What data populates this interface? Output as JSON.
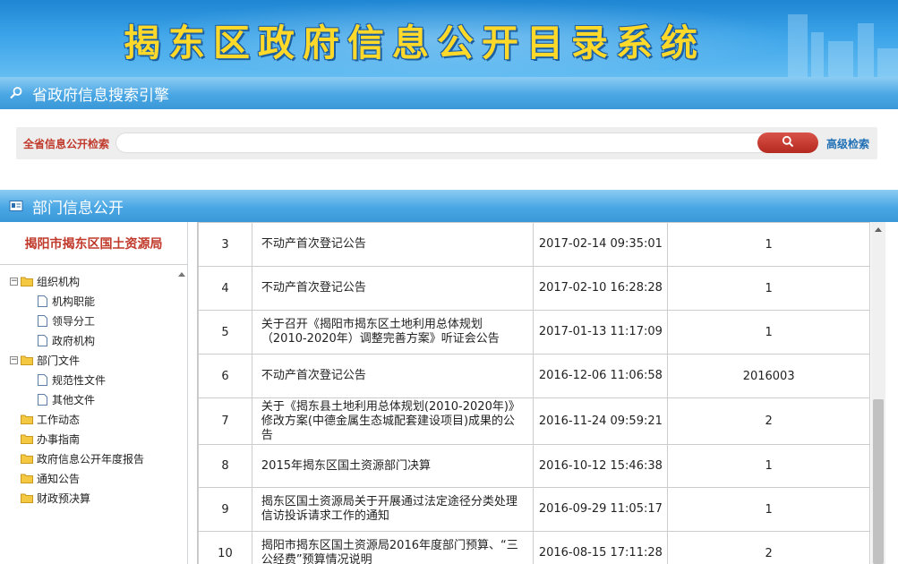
{
  "banner": {
    "title": "揭东区政府信息公开目录系统"
  },
  "search_section": {
    "title": "省政府信息搜索引擎",
    "label": "全省信息公开检索",
    "input_value": "",
    "advanced_label": "高级检索"
  },
  "dept_section": {
    "title": "部门信息公开"
  },
  "dept": {
    "name": "揭阳市揭东区国土资源局"
  },
  "tree": [
    {
      "label": "组织机构",
      "type": "folder",
      "toggle": "−"
    },
    {
      "label": "机构职能",
      "type": "doc"
    },
    {
      "label": "领导分工",
      "type": "doc"
    },
    {
      "label": "政府机构",
      "type": "doc"
    },
    {
      "label": "部门文件",
      "type": "folder",
      "toggle": "−"
    },
    {
      "label": "规范性文件",
      "type": "doc"
    },
    {
      "label": "其他文件",
      "type": "doc"
    },
    {
      "label": "工作动态",
      "type": "folder"
    },
    {
      "label": "办事指南",
      "type": "folder"
    },
    {
      "label": "政府信息公开年度报告",
      "type": "folder"
    },
    {
      "label": "通知公告",
      "type": "folder"
    },
    {
      "label": "财政预决算",
      "type": "folder"
    }
  ],
  "rows": [
    {
      "num": "3",
      "title": "不动产首次登记公告",
      "date": "2017-02-14 09:35:01",
      "doc_no": "1"
    },
    {
      "num": "4",
      "title": "不动产首次登记公告",
      "date": "2017-02-10 16:28:28",
      "doc_no": "1"
    },
    {
      "num": "5",
      "title": "关于召开《揭阳市揭东区土地利用总体规划（2010-2020年）调整完善方案》听证会公告",
      "date": "2017-01-13 11:17:09",
      "doc_no": "1"
    },
    {
      "num": "6",
      "title": "不动产首次登记公告",
      "date": "2016-12-06 11:06:58",
      "doc_no": "2016003"
    },
    {
      "num": "7",
      "title": "关于《揭东县土地利用总体规划(2010-2020年)》修改方案(中德金属生态城配套建设项目)成果的公告",
      "date": "2016-11-24 09:59:21",
      "doc_no": "2"
    },
    {
      "num": "8",
      "title": "2015年揭东区国土资源部门决算",
      "date": "2016-10-12 15:46:38",
      "doc_no": "1"
    },
    {
      "num": "9",
      "title": "揭东区国土资源局关于开展通过法定途径分类处理信访投诉请求工作的通知",
      "date": "2016-09-29 11:05:17",
      "doc_no": "1"
    },
    {
      "num": "10",
      "title": "揭阳市揭东区国土资源局2016年度部门预算、“三公经费”预算情况说明",
      "date": "2016-08-15 17:11:28",
      "doc_no": "2"
    }
  ],
  "colors": {
    "banner_title": "#ffd92a",
    "accent_red": "#c0392b",
    "link_blue": "#1f6fb5",
    "bar_blue": "#4aa7e4"
  }
}
